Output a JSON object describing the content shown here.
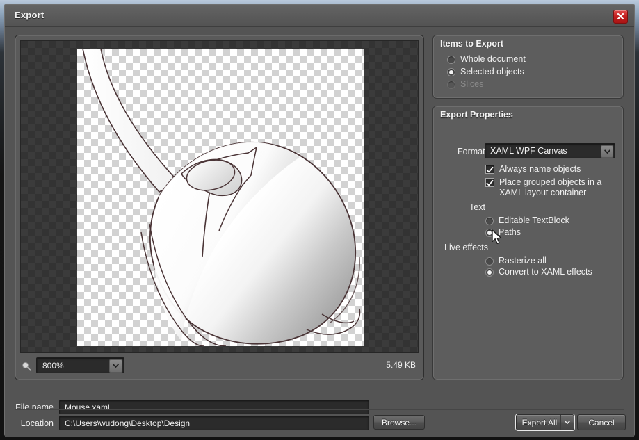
{
  "window": {
    "title": "Export",
    "close_icon": "close-icon"
  },
  "preview": {
    "zoom_value": "800%",
    "file_size": "5.49 KB",
    "magnifier_icon": "magnifier-icon",
    "artwork_alt": "computer-mouse-illustration"
  },
  "items_to_export": {
    "title": "Items to Export",
    "options": [
      {
        "label": "Whole document",
        "selected": false,
        "disabled": false
      },
      {
        "label": "Selected objects",
        "selected": true,
        "disabled": false
      },
      {
        "label": "Slices",
        "selected": false,
        "disabled": true
      }
    ]
  },
  "export_properties": {
    "title": "Export Properties",
    "format_label": "Format",
    "format_value": "XAML WPF Canvas",
    "checkboxes": [
      {
        "label": "Always name objects",
        "checked": true
      },
      {
        "label": "Place grouped objects in a XAML layout container",
        "checked": true
      }
    ],
    "text_section": {
      "label": "Text",
      "options": [
        {
          "label": "Editable TextBlock",
          "selected": false
        },
        {
          "label": "Paths",
          "selected": true
        }
      ]
    },
    "live_effects_section": {
      "label": "Live effects",
      "options": [
        {
          "label": "Rasterize all",
          "selected": false
        },
        {
          "label": "Convert to XAML effects",
          "selected": true
        }
      ]
    }
  },
  "footer": {
    "file_name_label": "File name",
    "file_name_value": "Mouse.xaml",
    "location_label": "Location",
    "location_value": "C:\\Users\\wudong\\Desktop\\Design",
    "browse_label": "Browse...",
    "export_all_label": "Export All",
    "cancel_label": "Cancel"
  },
  "colors": {
    "accent_close": "#c21e1e",
    "panel_bg": "#5d5d5d",
    "dialog_bg": "#545454",
    "field_bg": "#2b2b2b"
  }
}
